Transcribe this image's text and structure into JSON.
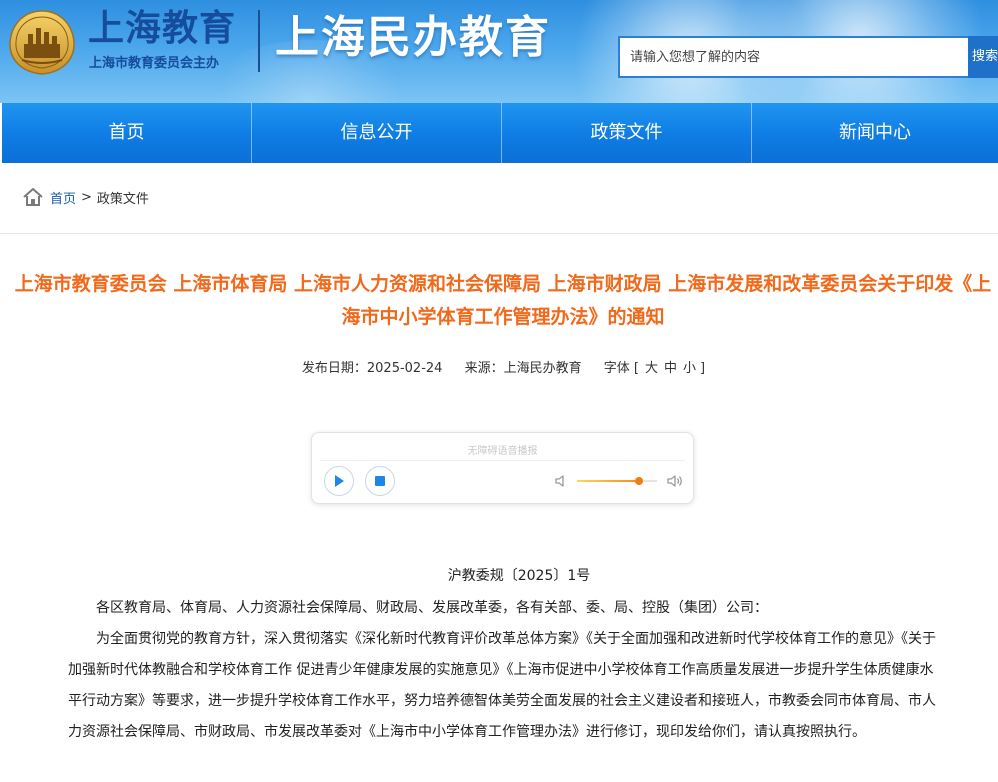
{
  "header": {
    "site_name": "上海教育",
    "site_sub": "上海市教育委员会主办",
    "title": "上海民办教育",
    "search_placeholder": "请输入您想了解的内容",
    "search_button": "搜索"
  },
  "nav": {
    "items": [
      {
        "label": "首页"
      },
      {
        "label": "信息公开"
      },
      {
        "label": "政策文件"
      },
      {
        "label": "新闻中心"
      }
    ]
  },
  "breadcrumb": {
    "home": "首页",
    "separator": ">",
    "current": "政策文件"
  },
  "article": {
    "title": "上海市教育委员会 上海市体育局 上海市人力资源和社会保障局 上海市财政局 上海市发展和改革委员会关于印发《上海市中小学体育工作管理办法》的通知",
    "publish_date": "发布日期：2025-02-24",
    "source": "来源：上海民办教育",
    "font_size_label": "字体 [",
    "font_size_large": "大",
    "font_size_medium": "中",
    "font_size_small": "小",
    "font_size_end": "]",
    "doc_number": "沪教委规〔2025〕1号",
    "paragraphs": [
      "各区教育局、体育局、人力资源社会保障局、财政局、发展改革委，各有关部、委、局、控股（集团）公司：",
      "为全面贯彻党的教育方针，深入贯彻落实《深化新时代教育评价改革总体方案》《关于全面加强和改进新时代学校体育工作的意见》《关于加强新时代体教融合和学校体育工作 促进青少年健康发展的实施意见》《上海市促进中小学校体育工作高质量发展进一步提升学生体质健康水平行动方案》等要求，进一步提升学校体育工作水平，努力培养德智体美劳全面发展的社会主义建设者和接班人，市教委会同市体育局、市人力资源社会保障局、市财政局、市发展改革委对《上海市中小学体育工作管理办法》进行修订，现印发给你们，请认真按照执行。"
    ]
  },
  "player": {
    "caption": "无障碍语音播报",
    "volume": 0.78,
    "accent_color": "#f07c12"
  },
  "colors": {
    "title": "#f2691b",
    "nav": "#0f7ce4",
    "brand": "#154c9c"
  }
}
